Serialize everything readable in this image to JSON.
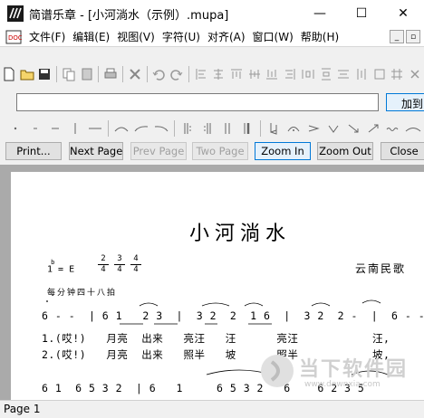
{
  "window": {
    "title": "简谱乐章 - [小河淌水（示例）.mupa]",
    "minimize": "—",
    "maximize": "☐",
    "close": "✕"
  },
  "menu": {
    "items": [
      "文件(F)",
      "编辑(E)",
      "视图(V)",
      "字符(U)",
      "对齐(A)",
      "窗口(W)",
      "帮助(H)"
    ],
    "mdi_minimize": "_",
    "mdi_restore": "▫"
  },
  "input_row": {
    "value": "",
    "add_label": "加到"
  },
  "preview": {
    "print": "Print...",
    "next_page": "Next Page",
    "prev_page": "Prev Page",
    "two_page": "Two Page",
    "zoom_in": "Zoom In",
    "zoom_out": "Zoom Out",
    "close": "Close"
  },
  "score": {
    "title": "小河淌水",
    "key": "1 = E",
    "key_flat": "b",
    "meters": [
      {
        "num": "2",
        "den": "4"
      },
      {
        "num": "3",
        "den": "4"
      },
      {
        "num": "4",
        "den": "4"
      }
    ],
    "composer": "云南民歌",
    "tempo": "每分钟四十八拍",
    "notes_line1": "6 - -  | 6 1   2 3  |  3 2  2  1 6  |  3 2  2 -  |  6 - -",
    "lyric_line1": "1.(哎!)   月亮  出来   亮汪   汪      亮汪           汪,",
    "lyric_line2": "2.(哎!)   月亮  出来   照半   坡      照半           坡,",
    "notes_line2": "6 1  6 5 3 2  | 6   1     6 5 3 2   6    6 2 3 5"
  },
  "watermark": {
    "text": "当下软件园",
    "url": "www.downxia.com"
  },
  "status": {
    "page": "Page 1"
  }
}
